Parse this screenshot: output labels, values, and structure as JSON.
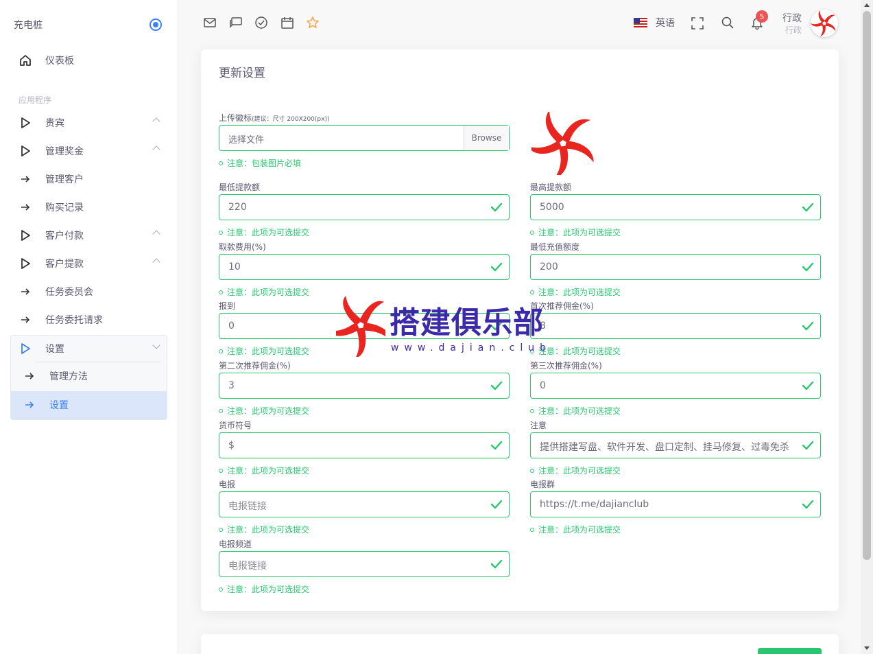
{
  "sidebar": {
    "brand": "充电桩",
    "dashboard": "仪表板",
    "section": "应用程序",
    "items": [
      {
        "label": "贵宾"
      },
      {
        "label": "管理奖金"
      },
      {
        "label": "管理客户"
      },
      {
        "label": "购买记录"
      },
      {
        "label": "客户付款"
      },
      {
        "label": "客户提款"
      },
      {
        "label": "任务委员会"
      },
      {
        "label": "任务委托请求"
      },
      {
        "label": "设置"
      },
      {
        "label": "管理方法"
      },
      {
        "label": "设置"
      }
    ]
  },
  "header": {
    "language": "英语",
    "notification_count": "5",
    "user_name": "行政",
    "user_role": "行政"
  },
  "form": {
    "title": "更新设置",
    "logo_label": "上传徽标",
    "logo_hint_small": "(建议：尺寸 200X200(px))",
    "file_placeholder": "选择文件",
    "browse": "Browse",
    "logo_note": "注意：包装图片必填",
    "optional_note": "注意：此项为可选提交",
    "fields": [
      {
        "label": "最低提款额",
        "value": "220"
      },
      {
        "label": "最高提款额",
        "value": "5000"
      },
      {
        "label": "取款费用(%)",
        "value": "10"
      },
      {
        "label": "最低充值额度",
        "value": "200"
      },
      {
        "label": "报到",
        "value": "0"
      },
      {
        "label": "首次推荐佣金(%)",
        "value": "8"
      },
      {
        "label": "第二次推荐佣金(%)",
        "value": "3"
      },
      {
        "label": "第三次推荐佣金(%)",
        "value": "0"
      },
      {
        "label": "货币符号",
        "value": "$"
      },
      {
        "label": "注意",
        "value": "提供搭建写盘、软件开发、盘口定制、挂马修复、过毒免杀"
      },
      {
        "label": "电报",
        "value": "电报链接"
      },
      {
        "label": "电报群",
        "value": "https://t.me/dajianclub"
      },
      {
        "label": "电报频道",
        "value": "电报链接"
      }
    ]
  },
  "watermark": {
    "title": "搭建俱乐部",
    "url": "www.dajian.club"
  },
  "colors": {
    "accent": "#3b82f6",
    "success": "#28c76f",
    "danger": "#ea5455",
    "active_bg": "#dbe6fa"
  }
}
